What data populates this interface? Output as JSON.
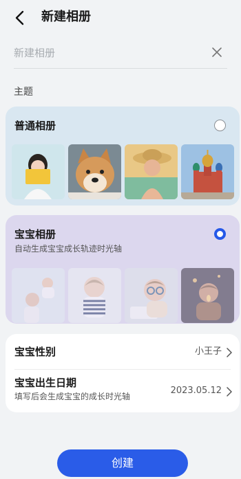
{
  "header": {
    "title": "新建相册",
    "back_icon": "chevron-left-icon"
  },
  "name_field": {
    "value": "",
    "placeholder": "新建相册",
    "clear_icon": "close-icon"
  },
  "theme_section": {
    "label": "主题"
  },
  "albums": [
    {
      "title": "普通相册",
      "subtitle": "",
      "selected": false,
      "thumbnails": [
        "girl-with-book",
        "shiba-dog",
        "smiling-woman-hat",
        "onion-dome-cathedral"
      ]
    },
    {
      "title": "宝宝相册",
      "subtitle": "自动生成宝宝成长轨迹时光轴",
      "selected": true,
      "thumbnails": [
        "parent-lifting-baby",
        "baby-striped-shirt",
        "baby-with-glasses",
        "baby-candle-light"
      ]
    }
  ],
  "baby_info": {
    "gender": {
      "label": "宝宝性别",
      "value": "小王子"
    },
    "birthday": {
      "label": "宝宝出生日期",
      "hint": "填写后会生成宝宝的成长时光轴",
      "value": "2023.05.12"
    }
  },
  "create_button": {
    "label": "创建"
  },
  "colors": {
    "accent": "#2a5ce8",
    "normal_card_bg": "#d9e7f1",
    "baby_card_bg": "#dcd7ee"
  }
}
